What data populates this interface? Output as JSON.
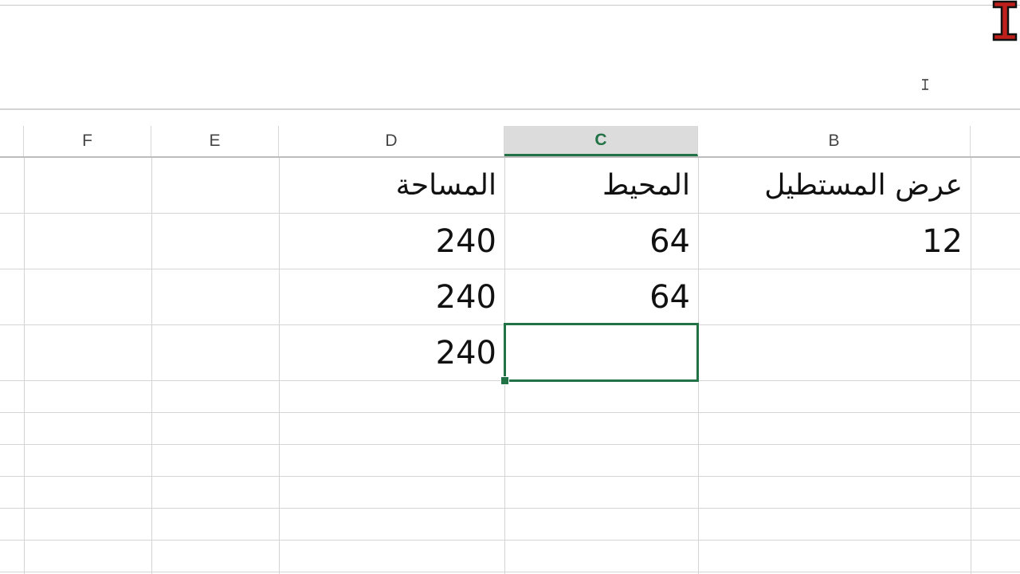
{
  "columns": [
    {
      "letter": "F",
      "selected": false
    },
    {
      "letter": "E",
      "selected": false
    },
    {
      "letter": "D",
      "selected": false
    },
    {
      "letter": "C",
      "selected": true
    },
    {
      "letter": "B",
      "selected": false
    }
  ],
  "rows": [
    {
      "B": "عرض المستطيل",
      "C": "المحيط",
      "D": "المساحة"
    },
    {
      "B": "12",
      "C": "64",
      "D": "240"
    },
    {
      "B": "",
      "C": "64",
      "D": "240"
    },
    {
      "B": "",
      "C": "",
      "D": "240"
    }
  ],
  "active_cell": {
    "column": "C",
    "row_index": 3
  },
  "colors": {
    "accent": "#217346",
    "gridline": "#d4d4d4",
    "selected_header_bg": "#dcdcdc"
  },
  "icons": {
    "cursor": "text-cursor-icon"
  }
}
